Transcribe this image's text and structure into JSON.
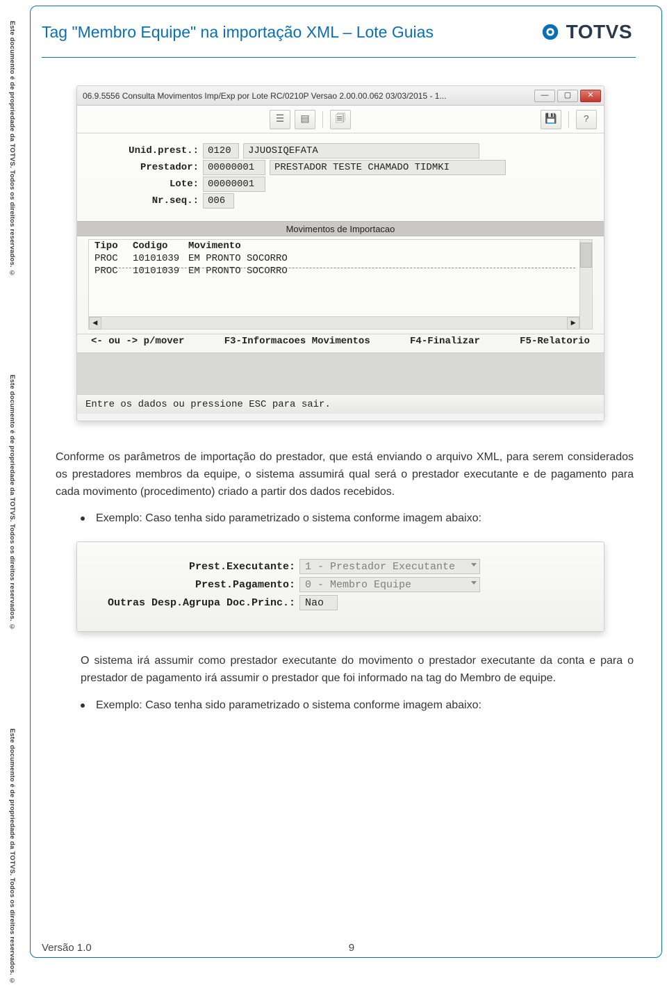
{
  "header": {
    "title": "Tag \"Membro Equipe\" na importação XML – Lote Guias",
    "brand": "TOTVS"
  },
  "sidebar_text": "Este documento é de propriedade da TOTVS. Todos os direitos reservados. ©",
  "screenshot1": {
    "window_title": "06.9.5556 Consulta Movimentos Imp/Exp por Lote RC/0210P Versao 2.00.00.062 03/03/2015 - 1...",
    "fields": {
      "unid_prest_label": "Unid.prest.:",
      "unid_prest_code": "0120",
      "unid_prest_name": "JJUOSIQEFATA",
      "prestador_label": "Prestador:",
      "prestador_code": "00000001",
      "prestador_name": "PRESTADOR TESTE CHAMADO TIDMKI",
      "lote_label": "Lote:",
      "lote_value": "00000001",
      "nrseq_label": "Nr.seq.:",
      "nrseq_value": "006"
    },
    "section_header": "Movimentos de Importacao",
    "columns": {
      "a": "Tipo",
      "b": "Codigo",
      "c": "Movimento"
    },
    "rows": [
      {
        "a": "PROC",
        "b": "10101039",
        "c": "EM PRONTO SOCORRO"
      },
      {
        "a": "PROC",
        "b": "10101039",
        "c": "EM PRONTO SOCORRO"
      }
    ],
    "hints": {
      "h1": "<- ou -> p/mover",
      "h2": "F3-Informacoes Movimentos",
      "h3": "F4-Finalizar",
      "h4": "F5-Relatorio"
    },
    "status": "Entre os dados ou pressione ESC para sair."
  },
  "para1": "Conforme os parâmetros de importação do prestador, que está enviando o arquivo XML, para serem considerados os prestadores membros da equipe, o sistema assumirá qual será o prestador executante e de pagamento para cada movimento (procedimento) criado a partir dos dados recebidos.",
  "bullet1": "Exemplo: Caso tenha sido parametrizado o sistema conforme imagem abaixo:",
  "screenshot2": {
    "rows": [
      {
        "label": "Prest.Executante:",
        "value": "1 - Prestador Executante",
        "dropdown": true
      },
      {
        "label": "Prest.Pagamento:",
        "value": "0 - Membro Equipe",
        "dropdown": true
      },
      {
        "label": "Outras Desp.Agrupa Doc.Princ.:",
        "value": "Nao",
        "dropdown": false
      }
    ]
  },
  "para2": "O sistema irá assumir como prestador executante do movimento o prestador executante da conta e para o prestador de pagamento irá assumir o prestador que foi informado na tag do Membro de equipe.",
  "bullet2": "Exemplo: Caso tenha sido parametrizado o sistema conforme imagem abaixo:",
  "footer": {
    "version": "Versão 1.0",
    "page": "9"
  }
}
